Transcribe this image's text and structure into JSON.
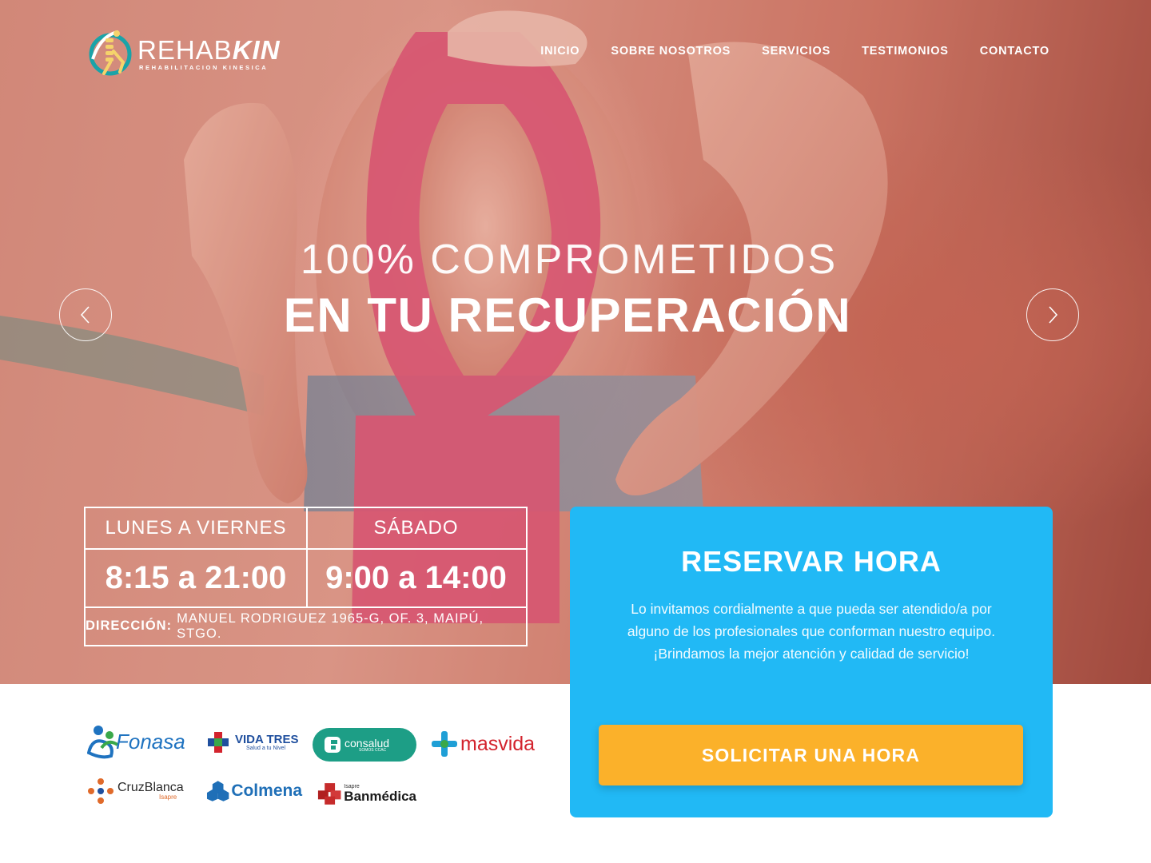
{
  "brand": {
    "name_light": "REHAB",
    "name_bold": "KIN",
    "tagline": "REHABILITACION KINESICA"
  },
  "nav": {
    "items": [
      {
        "label": "INICIO"
      },
      {
        "label": "SOBRE NOSOTROS"
      },
      {
        "label": "SERVICIOS"
      },
      {
        "label": "TESTIMONIOS"
      },
      {
        "label": "CONTACTO"
      }
    ]
  },
  "hero": {
    "headline_line1": "100% COMPROMETIDOS",
    "headline_line2": "EN TU RECUPERACIÓN",
    "prev_icon": "chevron-left-icon",
    "next_icon": "chevron-right-icon"
  },
  "schedule": {
    "weekday_label": "LUNES A VIERNES",
    "weekday_hours": "8:15 a 21:00",
    "saturday_label": "SÁBADO",
    "saturday_hours": "9:00 a 14:00",
    "address_label": "DIRECCIÓN:",
    "address_value": "MANUEL RODRIGUEZ 1965-G, OF. 3, MAIPÚ, STGO."
  },
  "booking": {
    "title": "RESERVAR HORA",
    "description": "Lo invitamos cordialmente a que pueda ser atendido/a por alguno de los profesionales que conforman nuestro equipo. ¡Brindamos la mejor atención y calidad de servicio!",
    "cta_label": "SOLICITAR UNA HORA"
  },
  "insurers": {
    "fonasa": "Fonasa",
    "vidatres": "VIDA TRES",
    "vidatres_sub": "Salud a tu Nivel",
    "consalud": "consalud",
    "consalud_sub": "SOMOS CCAC",
    "masvida": "masvida",
    "cruzblanca": "CruzBlanca",
    "cruzblanca_sub": "Isapre",
    "colmena": "Colmena",
    "banmedica_sub": "Isapre",
    "banmedica": "Banmédica"
  },
  "colors": {
    "accent_blue": "#21b9f5",
    "cta_orange": "#fbb12a",
    "logo_teal": "#1aa3a8",
    "consalud_green": "#1d9e86",
    "colmena_blue": "#1f6fb7",
    "banmedica_red": "#c62b2b",
    "masvida_red": "#d3232d"
  }
}
